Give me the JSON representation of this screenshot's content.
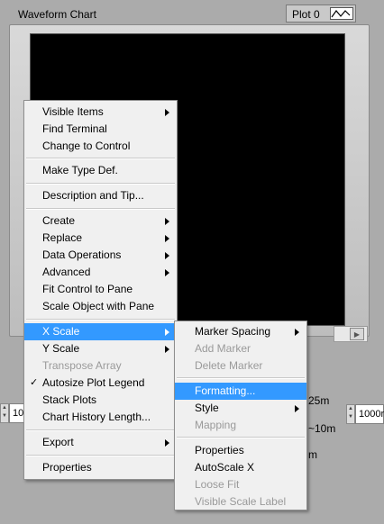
{
  "chart": {
    "label": "Waveform Chart",
    "legend_plot_name": "Plot 0"
  },
  "background": {
    "x_min_value": "10",
    "x_max_value": "1000r",
    "text_a": "25m",
    "text_b": "~10m",
    "text_c": "m"
  },
  "main_menu": {
    "items": [
      {
        "label": "Visible Items",
        "submenu": true
      },
      {
        "label": "Find Terminal"
      },
      {
        "label": "Change to Control"
      },
      {
        "label": "Make Type Def."
      },
      {
        "label": "Description and Tip..."
      },
      {
        "label": "Create",
        "submenu": true
      },
      {
        "label": "Replace",
        "submenu": true
      },
      {
        "label": "Data Operations",
        "submenu": true
      },
      {
        "label": "Advanced",
        "submenu": true
      },
      {
        "label": "Fit Control to Pane"
      },
      {
        "label": "Scale Object with Pane"
      },
      {
        "label": "X Scale",
        "submenu": true,
        "highlighted": true
      },
      {
        "label": "Y Scale",
        "submenu": true
      },
      {
        "label": "Transpose Array",
        "disabled": true
      },
      {
        "label": "Autosize Plot Legend",
        "checked": true
      },
      {
        "label": "Stack Plots"
      },
      {
        "label": "Chart History Length..."
      },
      {
        "label": "Export",
        "submenu": true
      },
      {
        "label": "Properties"
      }
    ]
  },
  "sub_menu": {
    "items": [
      {
        "label": "Marker Spacing",
        "submenu": true
      },
      {
        "label": "Add Marker",
        "disabled": true
      },
      {
        "label": "Delete Marker",
        "disabled": true
      },
      {
        "label": "Formatting...",
        "highlighted": true
      },
      {
        "label": "Style",
        "submenu": true
      },
      {
        "label": "Mapping",
        "disabled": true
      },
      {
        "label": "Properties"
      },
      {
        "label": "AutoScale X"
      },
      {
        "label": "Loose Fit",
        "disabled": true
      },
      {
        "label": "Visible Scale Label",
        "disabled": true
      }
    ]
  },
  "colors": {
    "highlight": "#3399ff",
    "menu_bg": "#f0f0f0",
    "panel_bg": "#ababab",
    "plot_bg": "#000000"
  }
}
